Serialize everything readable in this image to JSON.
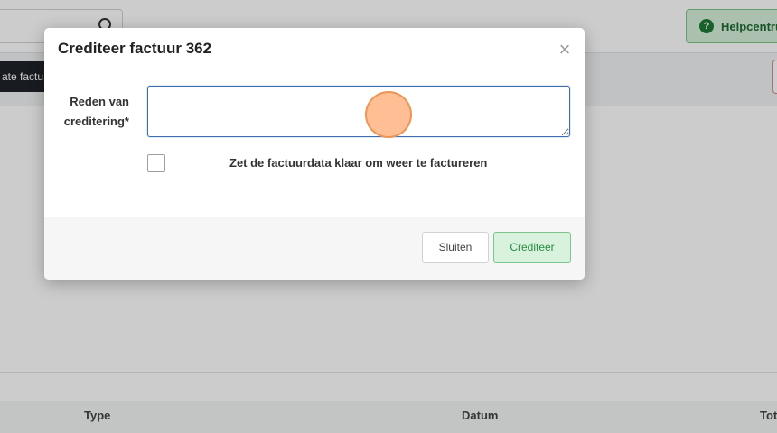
{
  "background": {
    "help_button_label": "Helpcentrum",
    "help_icon_glyph": "?",
    "dark_button_label": "ate factu",
    "table_headers": [
      "Type",
      "Datum",
      "Tot"
    ]
  },
  "modal": {
    "title": "Crediteer factuur 362",
    "close_glyph": "×",
    "reason_label_line1": "Reden van",
    "reason_label_line2": "creditering*",
    "reason_value": "",
    "checkbox_label": "Zet de factuurdata klaar om weer te factureren",
    "checkbox_checked": false,
    "close_button_label": "Sluiten",
    "credit_button_label": "Crediteer"
  },
  "colors": {
    "accent_blue": "#3d6fb0",
    "success_green": "#2b8a42",
    "success_bg": "#d9f2de"
  }
}
